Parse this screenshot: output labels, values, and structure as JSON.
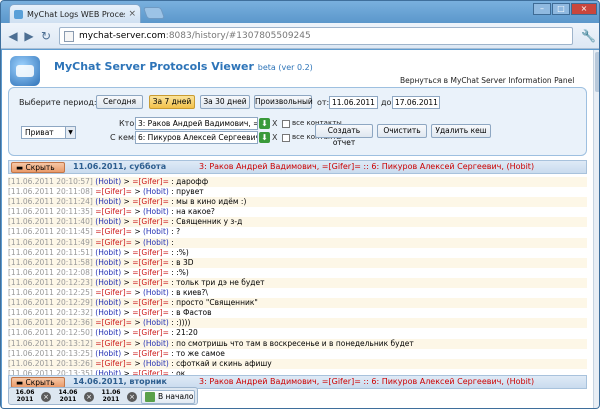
{
  "browser": {
    "tab_title": "MyChat Logs WEB Process",
    "url_host": "mychat-server.com",
    "url_path": ":8083/history/#1307805509245"
  },
  "app": {
    "title": "MyChat Server Protocols Viewer",
    "beta": "beta (ver 0.2)",
    "back_link": "Вернуться в MyChat Server Information Panel"
  },
  "filter": {
    "period_label": "Выберите период:",
    "btn_today": "Сегодня",
    "btn_7days": "За 7 дней",
    "btn_30days": "За 30 дней",
    "btn_custom": "Произвольный",
    "from_label": "от:",
    "from_value": "11.06.2011",
    "to_label": "до:",
    "to_value": "17.06.2011",
    "type_value": "Приват",
    "who_label": "Кто:",
    "who_value": "3: Раков Андрей Вадимович, =[Gifer]=",
    "with_label": "С кем:",
    "with_value": "6: Пикуров Алексей Сергеевич, (Hobit)",
    "x_label": "X",
    "all_contacts": "все контакты",
    "btn_report": "Создать отчет",
    "btn_clear": "Очистить",
    "btn_clear_cache": "Удалить кеш"
  },
  "day1": {
    "hide": "Скрыть",
    "date": "11.06.2011, суббота",
    "peer_a": "3: Раков Андрей Вадимович, =[Gifer]=",
    "sep": " :: ",
    "peer_b": "6: Пикуров Алексей Сергеевич, (Hobit)"
  },
  "messages": [
    {
      "ts": "[11.06.2011 20:10:57]",
      "from": "(Hobit)",
      "to": "=[Gifer]=",
      "text": "дарофф",
      "dir": "h"
    },
    {
      "ts": "[11.06.2011 20:11:08]",
      "from": "=[Gifer]=",
      "to": "(Hobit)",
      "text": "прувет",
      "dir": "g"
    },
    {
      "ts": "[11.06.2011 20:11:24]",
      "from": "(Hobit)",
      "to": "=[Gifer]=",
      "text": "мы в кино идём :)",
      "dir": "h"
    },
    {
      "ts": "[11.06.2011 20:11:35]",
      "from": "=[Gifer]=",
      "to": "(Hobit)",
      "text": "на какое?",
      "dir": "g"
    },
    {
      "ts": "[11.06.2011 20:11:40]",
      "from": "(Hobit)",
      "to": "=[Gifer]=",
      "text": "Священник у з-д",
      "dir": "h"
    },
    {
      "ts": "[11.06.2011 20:11:45]",
      "from": "=[Gifer]=",
      "to": "(Hobit)",
      "text": "?",
      "dir": "g"
    },
    {
      "ts": "[11.06.2011 20:11:49]",
      "from": "=[Gifer]=",
      "to": "(Hobit)",
      "text": "",
      "dir": "g"
    },
    {
      "ts": "[11.06.2011 20:11:51]",
      "from": "(Hobit)",
      "to": "=[Gifer]=",
      "text": ":%)",
      "dir": "h"
    },
    {
      "ts": "[11.06.2011 20:11:58]",
      "from": "(Hobit)",
      "to": "=[Gifer]=",
      "text": "в 3D",
      "dir": "h"
    },
    {
      "ts": "[11.06.2011 20:12:08]",
      "from": "(Hobit)",
      "to": "=[Gifer]=",
      "text": ":%)",
      "dir": "h"
    },
    {
      "ts": "[11.06.2011 20:12:23]",
      "from": "(Hobit)",
      "to": "=[Gifer]=",
      "text": "тольк три дэ не будет",
      "dir": "h"
    },
    {
      "ts": "[11.06.2011 20:12:25]",
      "from": "=[Gifer]=",
      "to": "(Hobit)",
      "text": "в киев?\\",
      "dir": "g"
    },
    {
      "ts": "[11.06.2011 20:12:29]",
      "from": "(Hobit)",
      "to": "=[Gifer]=",
      "text": "просто \"Священник\"",
      "dir": "h"
    },
    {
      "ts": "[11.06.2011 20:12:32]",
      "from": "(Hobit)",
      "to": "=[Gifer]=",
      "text": "в Фастов",
      "dir": "h"
    },
    {
      "ts": "[11.06.2011 20:12:36]",
      "from": "=[Gifer]=",
      "to": "(Hobit)",
      "text": ":))))",
      "dir": "g"
    },
    {
      "ts": "[11.06.2011 20:12:50]",
      "from": "(Hobit)",
      "to": "=[Gifer]=",
      "text": "21:20",
      "dir": "h"
    },
    {
      "ts": "[11.06.2011 20:13:12]",
      "from": "=[Gifer]=",
      "to": "(Hobit)",
      "text": "по смотришь что там в воскресенье и в понедельник будет",
      "dir": "g"
    },
    {
      "ts": "[11.06.2011 20:13:25]",
      "from": "(Hobit)",
      "to": "=[Gifer]=",
      "text": "то же самое",
      "dir": "h"
    },
    {
      "ts": "[11.06.2011 20:13:26]",
      "from": "=[Gifer]=",
      "to": "(Hobit)",
      "text": "сфоткай и скинь афишу",
      "dir": "g"
    },
    {
      "ts": "[11.06.2011 20:13:35]",
      "from": "(Hobit)",
      "to": "=[Gifer]=",
      "text": "ок",
      "dir": "h"
    },
    {
      "ts": "[11.06.2011 20:13:36]",
      "from": "=[Gifer]=",
      "to": "(Hobit)",
      "text": "время интересует",
      "dir": "g"
    }
  ],
  "day2": {
    "hide": "Скрыть",
    "date": "14.06.2011, вторник",
    "peer_a": "3: Раков Андрей Вадимович, =[Gifer]=",
    "sep": " :: ",
    "peer_b": "6: Пикуров Алексей Сергеевич, (Hobit)"
  },
  "day_tabs": [
    {
      "line1": "16.06",
      "line2": "2011"
    },
    {
      "line1": "14.06",
      "line2": "2011"
    },
    {
      "line1": "11.06",
      "line2": "2011"
    }
  ],
  "home_label": "В начало",
  "sep_arrow": ">",
  "sep_colon": ":"
}
